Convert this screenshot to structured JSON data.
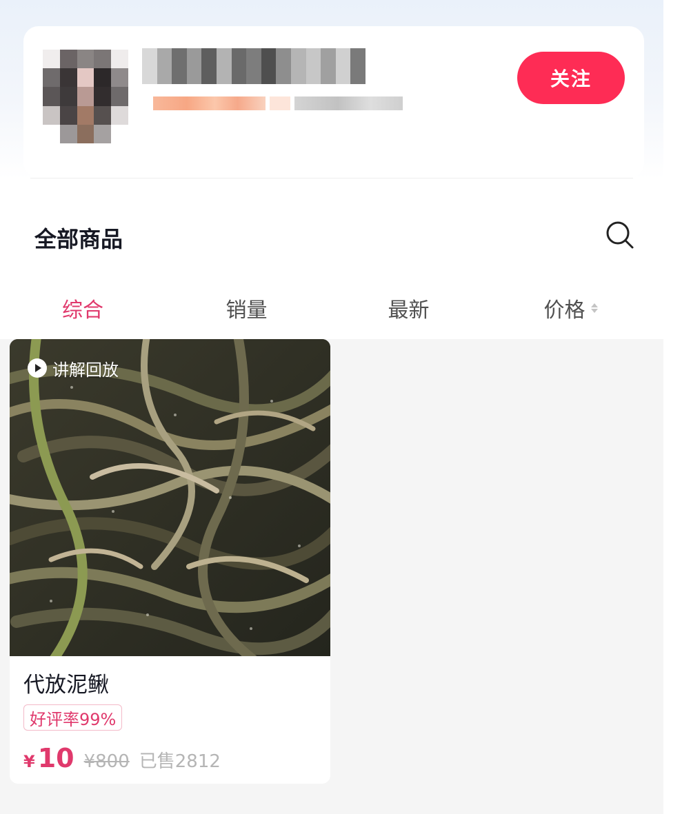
{
  "header": {
    "follow_label": "关注",
    "shop_name_redacted": true
  },
  "section": {
    "title": "全部商品",
    "search_icon": "search-icon"
  },
  "tabs": [
    {
      "label": "综合",
      "active": true
    },
    {
      "label": "销量",
      "active": false
    },
    {
      "label": "最新",
      "active": false
    },
    {
      "label": "价格",
      "active": false,
      "sortable": true
    }
  ],
  "products": [
    {
      "badge": "讲解回放",
      "title": "代放泥鳅",
      "rating_tag": "好评率99%",
      "price_symbol": "¥",
      "price": "10",
      "original_price": "¥800",
      "sold": "已售2812",
      "image": "loach-fish-photo"
    }
  ],
  "colors": {
    "accent": "#fe2c55",
    "accent_text": "#e0396c",
    "muted": "#b5b5b5",
    "grid_bg": "#f5f5f5"
  }
}
